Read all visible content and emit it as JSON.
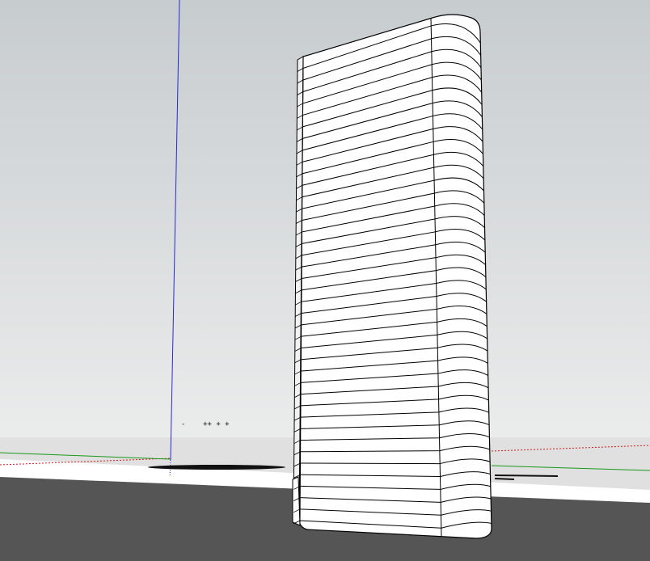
{
  "viewport": {
    "sky_top_color": "#c7cccf",
    "sky_bottom_color": "#ebecec",
    "ground_color": "#c9cbc9",
    "ground_far_color": "#dfe0df",
    "dark_ground_color": "#555555",
    "axis_red": "#cc2020",
    "axis_green": "#1a9a1a",
    "axis_blue": "#2a2ad0"
  },
  "model": {
    "name": "tower",
    "floor_count": 40,
    "face_color": "#ffffff",
    "edge_color": "#000000",
    "side_shade": "#f2f2f2"
  },
  "annotation_glyphs": "-    ++ + +"
}
